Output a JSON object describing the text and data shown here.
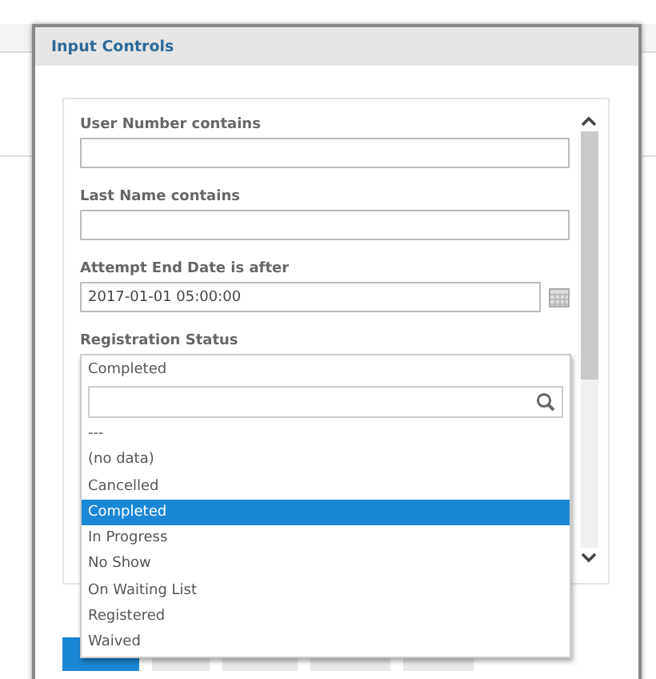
{
  "dialog": {
    "title": "Input Controls"
  },
  "fields": [
    {
      "kind": "text",
      "label": "User Number contains"
    },
    {
      "kind": "text",
      "label": "Last Name contains"
    },
    {
      "kind": "date",
      "label": "Attempt End Date is after",
      "value": "2017-01-01 05:00:00"
    }
  ],
  "registration_status": {
    "label": "Registration Status",
    "value": "Completed",
    "options": [
      {
        "label": "---",
        "selected": false
      },
      {
        "label": "(no data)",
        "selected": false
      },
      {
        "label": "Cancelled",
        "selected": false
      },
      {
        "label": "Completed",
        "selected": true
      },
      {
        "label": "In Progress",
        "selected": false
      },
      {
        "label": "No Show",
        "selected": false
      },
      {
        "label": "On Waiting List",
        "selected": false
      },
      {
        "label": "Registered",
        "selected": false
      },
      {
        "label": "Waived",
        "selected": false
      }
    ]
  },
  "buttons": [
    {
      "kind": "primary"
    },
    {
      "kind": "default"
    },
    {
      "kind": "default"
    },
    {
      "kind": "default"
    },
    {
      "kind": "default"
    }
  ]
}
